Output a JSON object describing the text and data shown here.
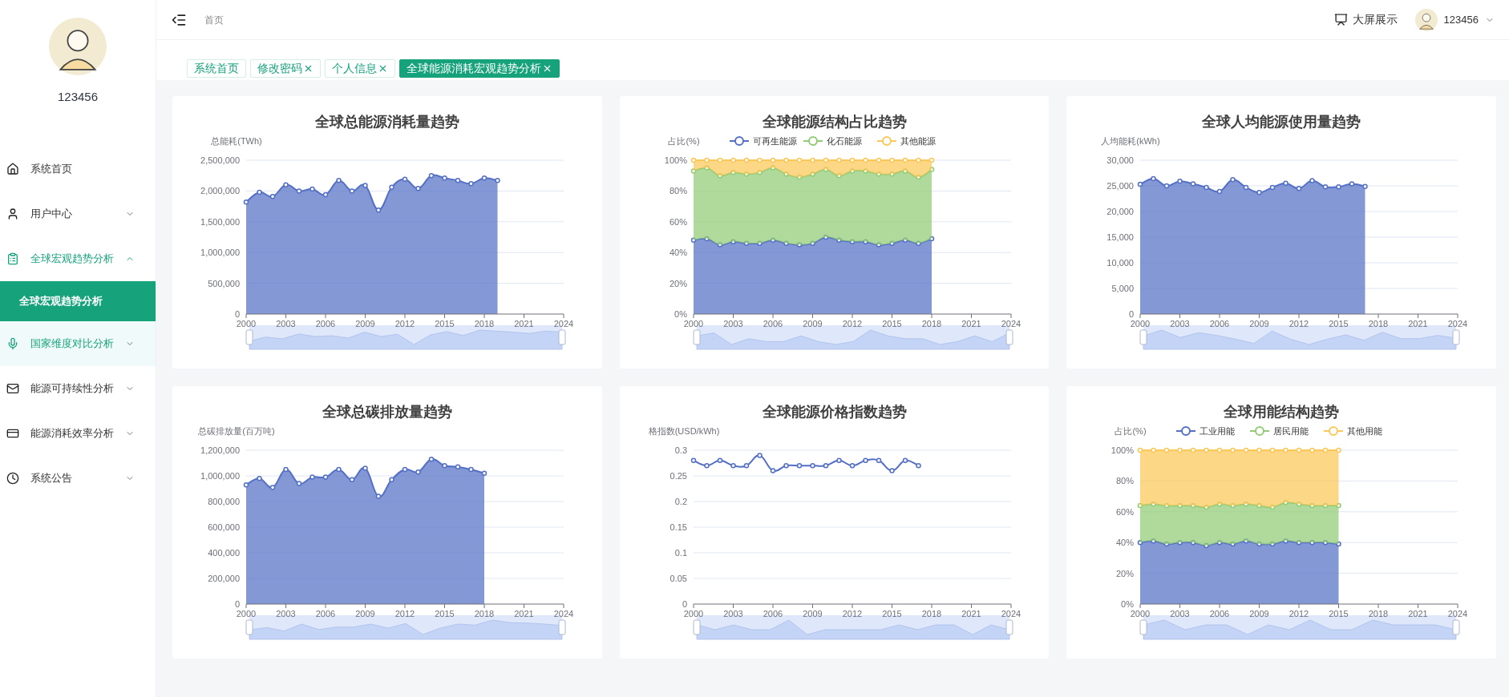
{
  "sidebar": {
    "user": {
      "name": "123456"
    },
    "items": [
      {
        "label": "系统首页",
        "selected": false,
        "hovered": false
      },
      {
        "label": "用户中心",
        "selected": false,
        "expanded": false,
        "hovered": false
      },
      {
        "label": "全球宏观趋势分析",
        "selected": true,
        "expanded": true,
        "hovered": false,
        "children": [
          {
            "label": "全球宏观趋势分析",
            "selected": true
          }
        ]
      },
      {
        "label": "国家维度对比分析",
        "selected": false,
        "expanded": false,
        "hovered": true
      },
      {
        "label": "能源可持续性分析",
        "selected": false,
        "expanded": false,
        "hovered": false
      },
      {
        "label": "能源消耗效率分析",
        "selected": false,
        "expanded": false,
        "hovered": false
      },
      {
        "label": "系统公告",
        "selected": false,
        "expanded": false,
        "hovered": false
      }
    ]
  },
  "header": {
    "breadcrumb": "首页",
    "screen_button": "大屏展示",
    "user": "123456"
  },
  "tabs": [
    {
      "label": "系统首页",
      "selected": false,
      "closable": false
    },
    {
      "label": "修改密码",
      "selected": false,
      "closable": true
    },
    {
      "label": "个人信息",
      "selected": false,
      "closable": true
    },
    {
      "label": "全球能源消耗宏观趋势分析",
      "selected": true,
      "closable": true
    }
  ],
  "charts": [
    {
      "chart_data": {
        "type": "area",
        "title": "全球总能源消耗量趋势",
        "ylabel": "总能耗(TWh)",
        "grid": true,
        "xlim": [
          2000,
          2024
        ],
        "ylim": [
          0,
          2500000
        ],
        "xticks": [
          2000,
          2003,
          2006,
          2009,
          2012,
          2015,
          2018,
          2021,
          2024
        ],
        "yticks": [
          {
            "value": 0,
            "label": "0"
          },
          {
            "value": 500000,
            "label": "500,000"
          },
          {
            "value": 1000000,
            "label": "1,000,000"
          },
          {
            "value": 1500000,
            "label": "1,500,000"
          },
          {
            "value": 2000000,
            "label": "2,000,000"
          },
          {
            "value": 2500000,
            "label": "2,500,000"
          }
        ],
        "x": [
          2000,
          2001,
          2002,
          2003,
          2004,
          2005,
          2006,
          2007,
          2008,
          2009,
          2010,
          2011,
          2012,
          2013,
          2014,
          2015,
          2016,
          2017,
          2018,
          2019
        ],
        "series": [
          {
            "color": "#5470c6",
            "marker": true,
            "values": [
              1820000,
              1980000,
              1910000,
              2100000,
              2000000,
              2030000,
              1940000,
              2170000,
              2000000,
              2090000,
              1690000,
              2060000,
              2190000,
              2040000,
              2250000,
              2210000,
              2170000,
              2120000,
              2210000,
              2170000
            ]
          }
        ]
      }
    },
    {
      "chart_data": {
        "type": "area",
        "title": "全球能源结构占比趋势",
        "ylabel": "占比(%)",
        "grid": true,
        "legend": "top",
        "stacked": true,
        "xlim": [
          2000,
          2024
        ],
        "ylim": [
          0,
          100
        ],
        "xticks": [
          2000,
          2003,
          2006,
          2009,
          2012,
          2015,
          2018,
          2021,
          2024
        ],
        "yticks": [
          {
            "value": 0,
            "label": "0%"
          },
          {
            "value": 20,
            "label": "20%"
          },
          {
            "value": 40,
            "label": "40%"
          },
          {
            "value": 60,
            "label": "60%"
          },
          {
            "value": 80,
            "label": "80%"
          },
          {
            "value": 100,
            "label": "100%"
          }
        ],
        "x": [
          2000,
          2001,
          2002,
          2003,
          2004,
          2005,
          2006,
          2007,
          2008,
          2009,
          2010,
          2011,
          2012,
          2013,
          2014,
          2015,
          2016,
          2017,
          2018
        ],
        "series": [
          {
            "name": "可再生能源",
            "color": "#5470c6",
            "marker": true,
            "values": [
              48,
              49,
              45,
              47,
              46,
              46,
              48,
              46,
              45,
              46,
              50,
              48,
              47,
              47,
              45,
              46,
              48,
              46,
              49
            ]
          },
          {
            "name": "化石能源",
            "color": "#91cc75",
            "marker": true,
            "values": [
              45,
              46,
              45,
              45,
              45,
              46,
              47,
              45,
              44,
              45,
              44,
              42,
              46,
              46,
              46,
              45,
              45,
              43,
              45
            ]
          },
          {
            "name": "其他能源",
            "color": "#fac858",
            "marker": true,
            "values": [
              7,
              5,
              10,
              8,
              9,
              8,
              5,
              9,
              11,
              9,
              6,
              10,
              7,
              7,
              9,
              9,
              7,
              11,
              6
            ]
          }
        ]
      }
    },
    {
      "chart_data": {
        "type": "area",
        "title": "全球人均能源使用量趋势",
        "ylabel": "人均能耗(kWh)",
        "grid": true,
        "xlim": [
          2000,
          2024
        ],
        "ylim": [
          0,
          30000
        ],
        "xticks": [
          2000,
          2003,
          2006,
          2009,
          2012,
          2015,
          2018,
          2021,
          2024
        ],
        "yticks": [
          {
            "value": 0,
            "label": "0"
          },
          {
            "value": 5000,
            "label": "5,000"
          },
          {
            "value": 10000,
            "label": "10,000"
          },
          {
            "value": 15000,
            "label": "15,000"
          },
          {
            "value": 20000,
            "label": "20,000"
          },
          {
            "value": 25000,
            "label": "25,000"
          },
          {
            "value": 30000,
            "label": "30,000"
          }
        ],
        "x": [
          2000,
          2001,
          2002,
          2003,
          2004,
          2005,
          2006,
          2007,
          2008,
          2009,
          2010,
          2011,
          2012,
          2013,
          2014,
          2015,
          2016,
          2017
        ],
        "series": [
          {
            "color": "#5470c6",
            "marker": true,
            "values": [
              25300,
              26400,
              25000,
              25900,
              25400,
              24700,
              23900,
              26200,
              24700,
              23700,
              24700,
              25500,
              24500,
              26000,
              24800,
              24800,
              25400,
              24900
            ]
          }
        ]
      }
    },
    {
      "chart_data": {
        "type": "area",
        "title": "全球总碳排放量趋势",
        "ylabel": "总碳排放量(百万吨)",
        "grid": true,
        "xlim": [
          2000,
          2024
        ],
        "ylim": [
          0,
          1200000
        ],
        "xticks": [
          2000,
          2003,
          2006,
          2009,
          2012,
          2015,
          2018,
          2021,
          2024
        ],
        "yticks": [
          {
            "value": 0,
            "label": "0"
          },
          {
            "value": 200000,
            "label": "200,000"
          },
          {
            "value": 400000,
            "label": "400,000"
          },
          {
            "value": 600000,
            "label": "600,000"
          },
          {
            "value": 800000,
            "label": "800,000"
          },
          {
            "value": 1000000,
            "label": "1,000,000"
          },
          {
            "value": 1200000,
            "label": "1,200,000"
          }
        ],
        "x": [
          2000,
          2001,
          2002,
          2003,
          2004,
          2005,
          2006,
          2007,
          2008,
          2009,
          2010,
          2011,
          2012,
          2013,
          2014,
          2015,
          2016,
          2017,
          2018
        ],
        "series": [
          {
            "color": "#5470c6",
            "marker": true,
            "values": [
              930000,
              980000,
              910000,
              1050000,
              940000,
              990000,
              990000,
              1050000,
              970000,
              1060000,
              840000,
              970000,
              1050000,
              1030000,
              1130000,
              1080000,
              1070000,
              1050000,
              1020000
            ]
          }
        ]
      }
    },
    {
      "chart_data": {
        "type": "line",
        "title": "全球能源价格指数趋势",
        "ylabel": "格指数(USD/kWh)",
        "grid": true,
        "xlim": [
          2000,
          2024
        ],
        "ylim": [
          0,
          0.3
        ],
        "xticks": [
          2000,
          2003,
          2006,
          2009,
          2012,
          2015,
          2018,
          2021,
          2024
        ],
        "yticks": [
          {
            "value": 0,
            "label": "0"
          },
          {
            "value": 0.05,
            "label": "0.05"
          },
          {
            "value": 0.1,
            "label": "0.1"
          },
          {
            "value": 0.15,
            "label": "0.15"
          },
          {
            "value": 0.2,
            "label": "0.2"
          },
          {
            "value": 0.25,
            "label": "0.25"
          },
          {
            "value": 0.3,
            "label": "0.3"
          }
        ],
        "x": [
          2000,
          2001,
          2002,
          2003,
          2004,
          2005,
          2006,
          2007,
          2008,
          2009,
          2010,
          2011,
          2012,
          2013,
          2014,
          2015,
          2016,
          2017
        ],
        "series": [
          {
            "color": "#5470c6",
            "marker": true,
            "values": [
              0.28,
              0.27,
              0.28,
              0.27,
              0.27,
              0.29,
              0.26,
              0.27,
              0.27,
              0.27,
              0.27,
              0.28,
              0.27,
              0.28,
              0.28,
              0.26,
              0.28,
              0.27
            ]
          }
        ]
      }
    },
    {
      "chart_data": {
        "type": "area",
        "title": "全球用能结构趋势",
        "ylabel": "占比(%)",
        "grid": true,
        "legend": "top",
        "stacked": true,
        "xlim": [
          2000,
          2024
        ],
        "ylim": [
          0,
          100
        ],
        "xticks": [
          2000,
          2003,
          2006,
          2009,
          2012,
          2015,
          2018,
          2021,
          2024
        ],
        "yticks": [
          {
            "value": 0,
            "label": "0%"
          },
          {
            "value": 20,
            "label": "20%"
          },
          {
            "value": 40,
            "label": "40%"
          },
          {
            "value": 60,
            "label": "60%"
          },
          {
            "value": 80,
            "label": "80%"
          },
          {
            "value": 100,
            "label": "100%"
          }
        ],
        "x": [
          2000,
          2001,
          2002,
          2003,
          2004,
          2005,
          2006,
          2007,
          2008,
          2009,
          2010,
          2011,
          2012,
          2013,
          2014,
          2015
        ],
        "series": [
          {
            "name": "工业用能",
            "color": "#5470c6",
            "marker": true,
            "values": [
              40,
              41,
              39,
              40,
              40,
              38,
              40,
              39,
              41,
              39,
              39,
              41,
              40,
              40,
              40,
              39
            ]
          },
          {
            "name": "居民用能",
            "color": "#91cc75",
            "marker": true,
            "values": [
              24,
              24,
              25,
              24,
              24,
              25,
              25,
              25,
              24,
              25,
              24,
              25,
              25,
              24,
              24,
              25
            ]
          },
          {
            "name": "其他用能",
            "color": "#fac858",
            "marker": true,
            "values": [
              36,
              35,
              36,
              36,
              36,
              37,
              35,
              36,
              35,
              36,
              37,
              34,
              35,
              36,
              36,
              36
            ]
          }
        ]
      }
    }
  ]
}
